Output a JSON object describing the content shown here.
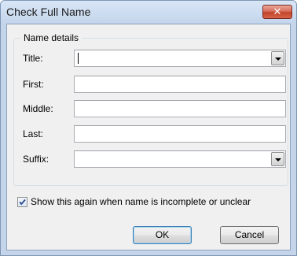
{
  "window": {
    "title": "Check Full Name",
    "close_glyph": "✕"
  },
  "group": {
    "legend": "Name details",
    "fields": [
      {
        "label": "Title:",
        "type": "combo",
        "value": ""
      },
      {
        "label": "First:",
        "type": "text",
        "value": ""
      },
      {
        "label": "Middle:",
        "type": "text",
        "value": ""
      },
      {
        "label": "Last:",
        "type": "text",
        "value": ""
      },
      {
        "label": "Suffix:",
        "type": "combo",
        "value": ""
      }
    ]
  },
  "option": {
    "label": "Show this again when name is incomplete or unclear",
    "checked": true
  },
  "buttons": {
    "ok": "OK",
    "cancel": "Cancel"
  },
  "colors": {
    "frame": "#c4d5ea",
    "close_button": "#c24428",
    "ok_focus": "#3c7fb1"
  }
}
